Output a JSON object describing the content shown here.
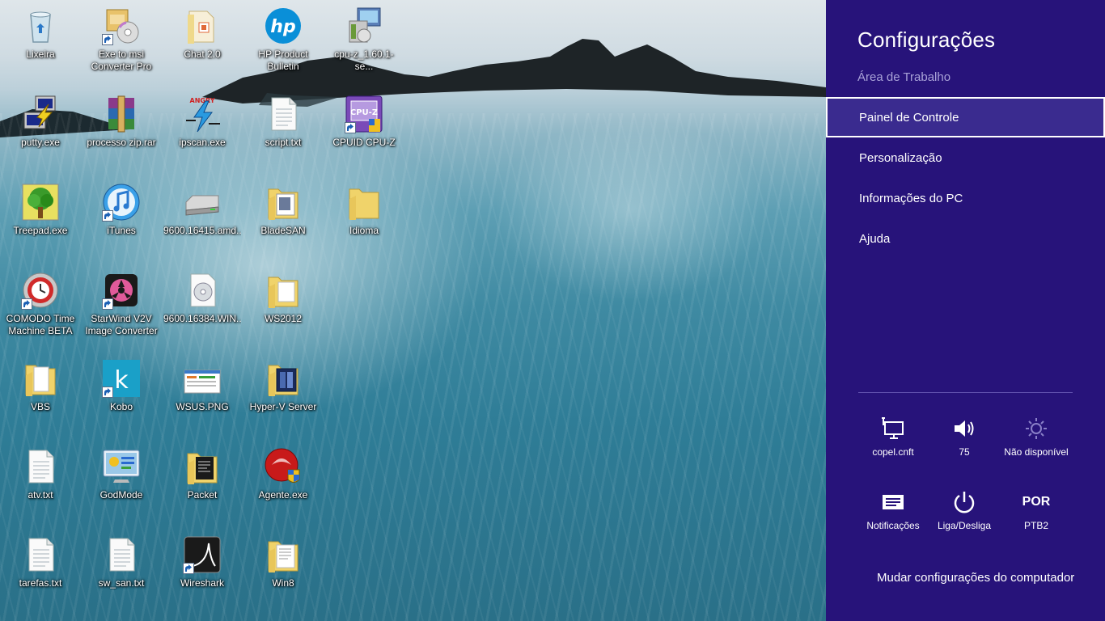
{
  "desktop": {
    "icons": [
      {
        "label": "Lixeira",
        "icon": "recycle-bin-icon"
      },
      {
        "label": "Exe to msi\nConverter Pro",
        "icon": "installer-icon"
      },
      {
        "label": "Chat 2.0",
        "icon": "folder-icon"
      },
      {
        "label": "HP Product\nBulletin",
        "icon": "hp-logo-icon"
      },
      {
        "label": "cpu-z_1.60.1-se...",
        "icon": "setup-package-icon"
      },
      {
        "label": "putty.exe",
        "icon": "putty-icon"
      },
      {
        "label": "processo zip.rar",
        "icon": "winrar-icon"
      },
      {
        "label": "ipscan.exe",
        "icon": "ipscan-icon"
      },
      {
        "label": "script.txt",
        "icon": "text-file-icon"
      },
      {
        "label": "CPUID CPU-Z",
        "icon": "cpuz-icon"
      },
      {
        "label": "Treepad.exe",
        "icon": "treepad-icon"
      },
      {
        "label": "iTunes",
        "icon": "itunes-icon"
      },
      {
        "label": "9600.16415.amd...",
        "icon": "drive-icon"
      },
      {
        "label": "BladeSAN",
        "icon": "folder-icon"
      },
      {
        "label": "Idioma",
        "icon": "folder-icon"
      },
      {
        "label": "COMODO Time\nMachine BETA",
        "icon": "comodo-icon"
      },
      {
        "label": "StarWind V2V\nImage Converter",
        "icon": "starwind-icon"
      },
      {
        "label": "9600.16384.WIN...",
        "icon": "disc-image-icon"
      },
      {
        "label": "WS2012",
        "icon": "folder-icon"
      },
      {
        "label": "VBS",
        "icon": "folder-icon"
      },
      {
        "label": "Kobo",
        "icon": "kobo-icon"
      },
      {
        "label": "WSUS.PNG",
        "icon": "image-file-icon"
      },
      {
        "label": "Hyper-V Server",
        "icon": "folder-icon"
      },
      {
        "label": "atv.txt",
        "icon": "text-file-icon"
      },
      {
        "label": "GodMode",
        "icon": "control-panel-icon"
      },
      {
        "label": "Packet",
        "icon": "folder-icon"
      },
      {
        "label": "Agente.exe",
        "icon": "agent-shield-icon"
      },
      {
        "label": "tarefas.txt",
        "icon": "text-file-icon"
      },
      {
        "label": "sw_san.txt",
        "icon": "text-file-icon"
      },
      {
        "label": "Wireshark",
        "icon": "wireshark-icon"
      },
      {
        "label": "Win8",
        "icon": "folder-icon"
      }
    ]
  },
  "charm": {
    "title": "Configurações",
    "subtitle": "Área de Trabalho",
    "links": [
      {
        "label": "Painel de Controle",
        "selected": true
      },
      {
        "label": "Personalização"
      },
      {
        "label": "Informações do PC"
      },
      {
        "label": "Ajuda"
      }
    ],
    "tiles": {
      "network": {
        "label": "copel.cnft",
        "icon": "network-icon"
      },
      "volume": {
        "label": "75",
        "icon": "volume-icon"
      },
      "brightness": {
        "label": "Não disponível",
        "icon": "brightness-icon"
      },
      "notifications": {
        "label": "Notificações",
        "icon": "notifications-icon"
      },
      "power": {
        "label": "Liga/Desliga",
        "icon": "power-icon"
      },
      "keyboard": {
        "code": "POR",
        "label": "PTB2"
      }
    },
    "pc_settings": "Mudar configurações do computador"
  },
  "colors": {
    "charm_background": "#27137a",
    "charm_selected_border": "#ffffff",
    "charm_subtitle": "#a9a2d8"
  }
}
